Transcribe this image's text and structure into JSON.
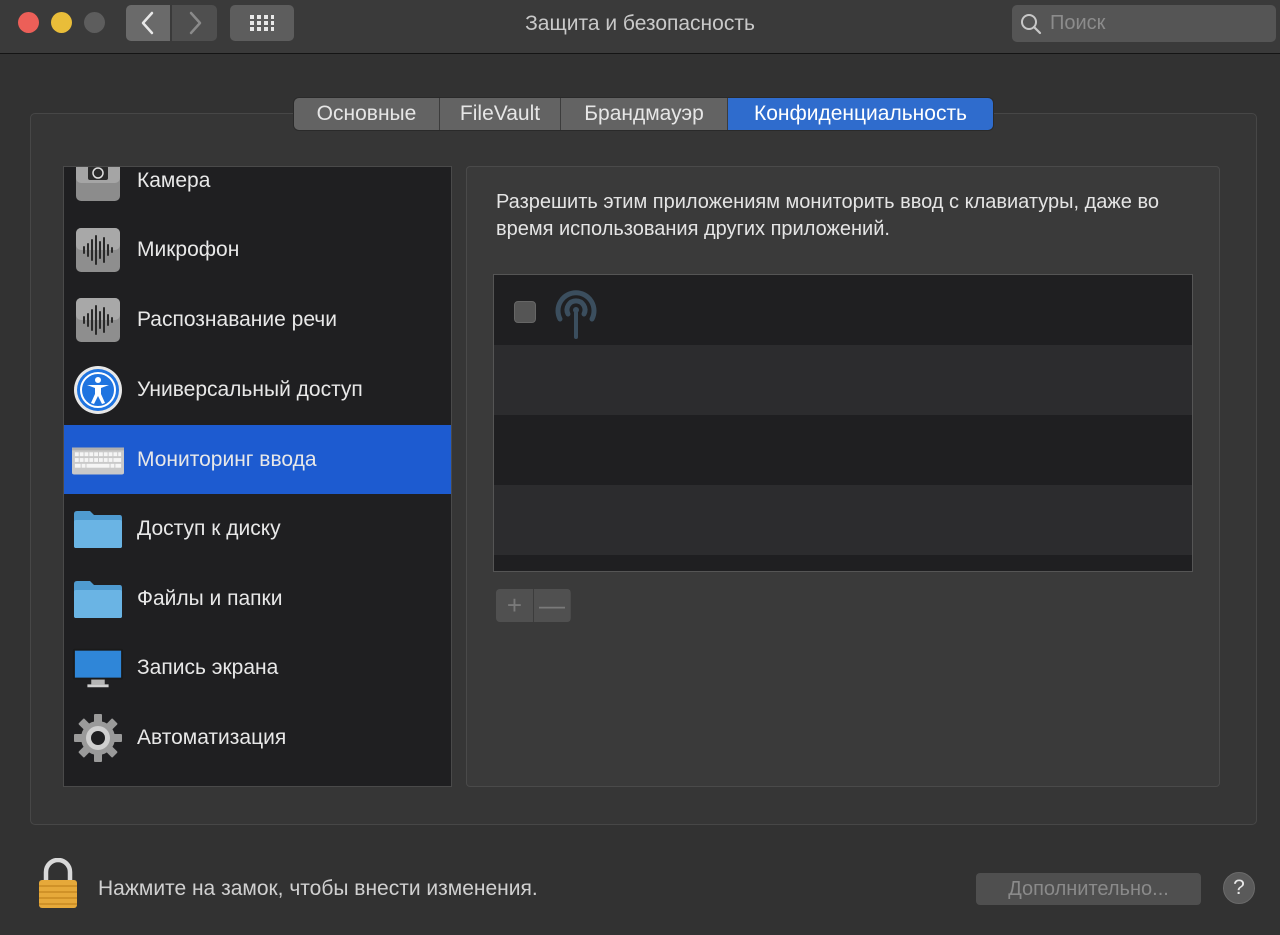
{
  "window": {
    "title": "Защита и безопасность"
  },
  "search": {
    "placeholder": "Поиск"
  },
  "tabs": [
    {
      "label": "Основные",
      "active": false
    },
    {
      "label": "FileVault",
      "active": false
    },
    {
      "label": "Брандмауэр",
      "active": false
    },
    {
      "label": "Конфиденциальность",
      "active": true
    }
  ],
  "sidebar": {
    "items": [
      {
        "label": "Камера",
        "icon": "camera-icon",
        "selected": false
      },
      {
        "label": "Микрофон",
        "icon": "microphone-icon",
        "selected": false
      },
      {
        "label": "Распознавание речи",
        "icon": "speech-recognition-icon",
        "selected": false
      },
      {
        "label": "Универсальный доступ",
        "icon": "accessibility-icon",
        "selected": false
      },
      {
        "label": "Мониторинг ввода",
        "icon": "keyboard-icon",
        "selected": true
      },
      {
        "label": "Доступ к диску",
        "icon": "folder-icon",
        "selected": false
      },
      {
        "label": "Файлы и папки",
        "icon": "folder-icon",
        "selected": false
      },
      {
        "label": "Запись экрана",
        "icon": "display-icon",
        "selected": false
      },
      {
        "label": "Автоматизация",
        "icon": "gear-icon",
        "selected": false
      }
    ]
  },
  "panel": {
    "description": "Разрешить этим приложениям мониторить ввод с клавиатуры, даже во время использования других приложений.",
    "apps": [
      {
        "checked": false,
        "icon": "app-signal-icon"
      }
    ],
    "add_label": "+",
    "remove_label": "—"
  },
  "footer": {
    "lock_text": "Нажмите на замок, чтобы внести изменения.",
    "advanced_label": "Дополнительно...",
    "help_label": "?"
  },
  "colors": {
    "accent": "#2f6ccd",
    "selection": "#1d5bd0",
    "close": "#ec5f58",
    "minimize": "#e9bd39"
  }
}
